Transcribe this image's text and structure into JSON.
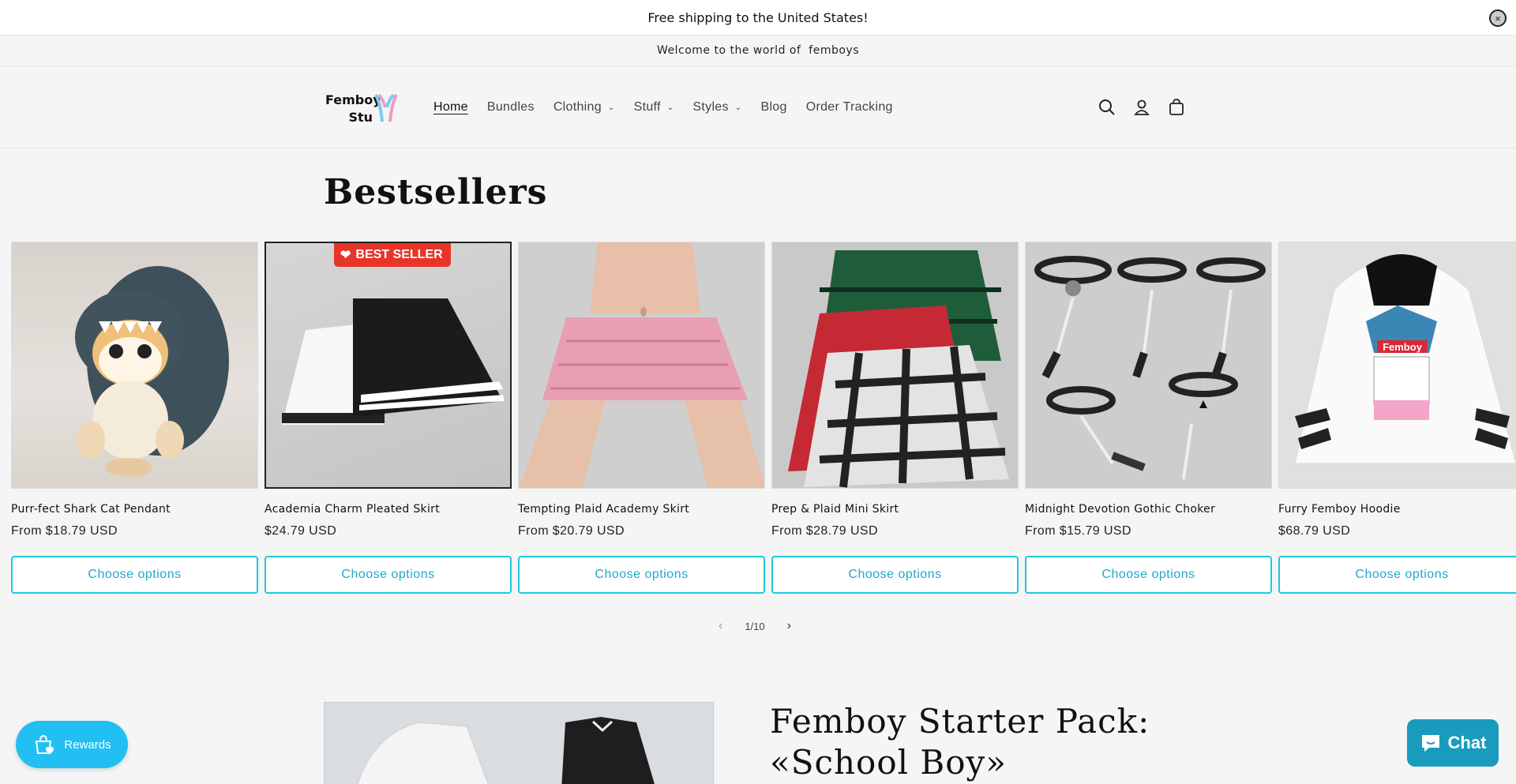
{
  "announcement": {
    "text": "Free shipping to the United States!",
    "close_glyph": "×"
  },
  "welcome": {
    "text": "Welcome to the world of  femboys"
  },
  "header": {
    "logo_line1": "Femboy",
    "logo_line2": "Stu",
    "nav": [
      {
        "label": "Home",
        "active": true,
        "has_dropdown": false
      },
      {
        "label": "Bundles",
        "has_dropdown": false
      },
      {
        "label": "Clothing",
        "has_dropdown": true
      },
      {
        "label": "Stuff",
        "has_dropdown": true
      },
      {
        "label": "Styles",
        "has_dropdown": true
      },
      {
        "label": "Blog",
        "has_dropdown": false
      },
      {
        "label": "Order Tracking",
        "has_dropdown": false
      }
    ],
    "icons": [
      "search-icon",
      "account-icon",
      "cart-icon"
    ]
  },
  "bestsellers": {
    "title": "Bestsellers",
    "badge": "BEST SELLER",
    "products": [
      {
        "title": "Purr-fect Shark Cat Pendant",
        "price": "From $18.79 USD",
        "button": "Choose options"
      },
      {
        "title": "Academia Charm Pleated Skirt",
        "price": "$24.79 USD",
        "button": "Choose options"
      },
      {
        "title": "Tempting Plaid Academy Skirt",
        "price": "From $20.79 USD",
        "button": "Choose options"
      },
      {
        "title": "Prep & Plaid Mini Skirt",
        "price": "From $28.79 USD",
        "button": "Choose options"
      },
      {
        "title": "Midnight Devotion Gothic Choker",
        "price": "From $15.79 USD",
        "button": "Choose options"
      },
      {
        "title": "Furry Femboy Hoodie",
        "price": "$68.79 USD",
        "button": "Choose options"
      }
    ],
    "hoodie_print": "Femboy",
    "pager": {
      "current": "1/10",
      "prev": "‹",
      "next": "›"
    }
  },
  "feature": {
    "title_line1": "Femboy Starter Pack:",
    "title_line2": "«School Boy»"
  },
  "rewards": {
    "label": "Rewards"
  },
  "chat": {
    "label": "Chat"
  },
  "colors": {
    "accent": "#1ec8e0",
    "badge": "#e8352a",
    "rewards": "#21bff2",
    "chat": "#1a9bbd"
  }
}
